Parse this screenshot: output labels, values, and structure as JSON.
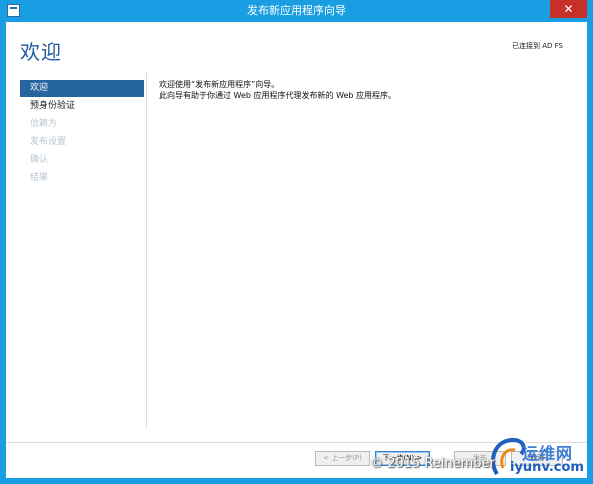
{
  "window": {
    "title": "发布新应用程序向导",
    "close": "✕"
  },
  "header": {
    "page_title": "欢迎",
    "status": "已连接到 AD FS"
  },
  "nav": {
    "items": [
      {
        "label": "欢迎",
        "state": "active"
      },
      {
        "label": "预身份验证",
        "state": "enabled"
      },
      {
        "label": "信赖方",
        "state": "disabled"
      },
      {
        "label": "发布设置",
        "state": "disabled"
      },
      {
        "label": "确认",
        "state": "disabled"
      },
      {
        "label": "结果",
        "state": "disabled"
      }
    ]
  },
  "content": {
    "line1": "欢迎使用“发布新应用程序”向导。",
    "line2": "此向导有助于你通过 Web 应用程序代理发布新的 Web 应用程序。"
  },
  "buttons": {
    "prev": "< 上一步(P)",
    "next": "下一步(N) >",
    "publish": "发布",
    "cancel": "取消"
  },
  "watermark": {
    "copyright": "© 2015 Reinember",
    "brand_cn": "运维网",
    "brand_url": "iyunv.com"
  },
  "colors": {
    "titlebar": "#1a9ee3",
    "accent": "#26659f",
    "close": "#c7302a"
  }
}
